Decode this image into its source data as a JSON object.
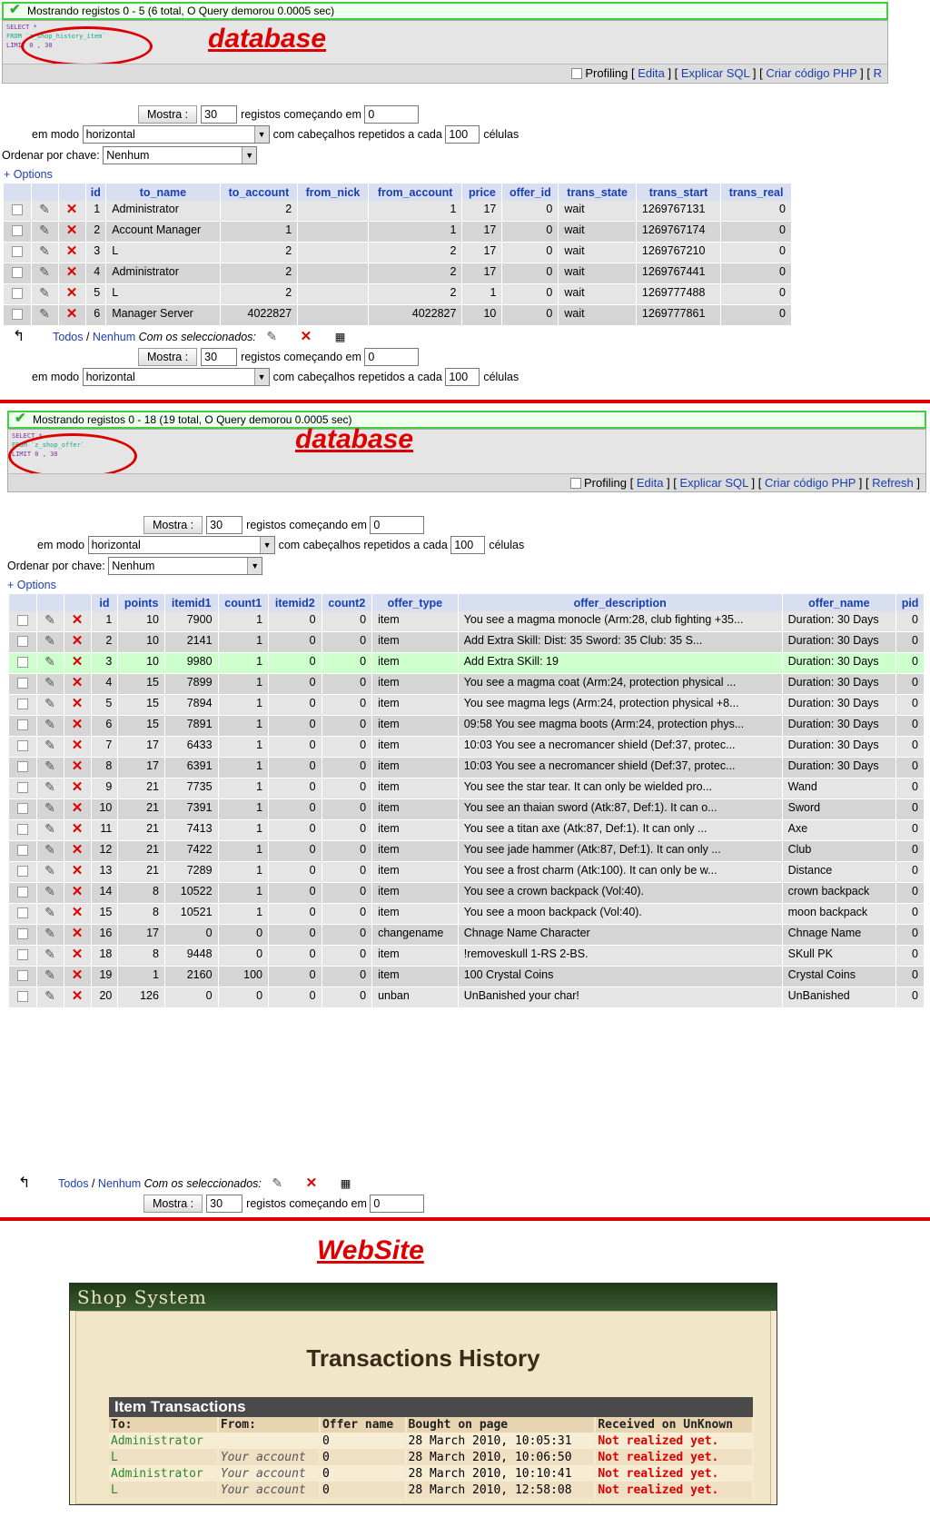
{
  "section1": {
    "message": "Mostrando registos 0 - 5 (6 total, O Query demorou 0.0005 sec)",
    "sql": [
      "SELECT *",
      "FROM `z_shop_history_item`",
      "LIMIT 0 , 30"
    ],
    "annotation": "database",
    "sqlbar": {
      "profiling": "Profiling",
      "edit": "Edita",
      "explain": "Explicar SQL",
      "php": "Criar código PHP",
      "refresh": "R"
    },
    "controls": {
      "show_btn": "Mostra :",
      "rows": "30",
      "start_label": "registos começando em",
      "start": "0",
      "mode_label": "em modo",
      "mode": "horizontal",
      "repeat_label": "com cabeçalhos repetidos a cada",
      "repeat": "100",
      "cells_label": "células",
      "sort_label": "Ordenar por chave:",
      "sort": "Nenhum"
    },
    "options": "+ Options",
    "columns": [
      "id",
      "to_name",
      "to_account",
      "from_nick",
      "from_account",
      "price",
      "offer_id",
      "trans_state",
      "trans_start",
      "trans_real"
    ],
    "rows": [
      [
        "1",
        "Administrator",
        "2",
        "",
        "1",
        "17",
        "0",
        "wait",
        "1269767131",
        "0"
      ],
      [
        "2",
        "Account Manager",
        "1",
        "",
        "1",
        "17",
        "0",
        "wait",
        "1269767174",
        "0"
      ],
      [
        "3",
        "L",
        "2",
        "",
        "2",
        "17",
        "0",
        "wait",
        "1269767210",
        "0"
      ],
      [
        "4",
        "Administrator",
        "2",
        "",
        "2",
        "17",
        "0",
        "wait",
        "1269767441",
        "0"
      ],
      [
        "5",
        "L",
        "2",
        "",
        "2",
        "1",
        "0",
        "wait",
        "1269777488",
        "0"
      ],
      [
        "6",
        "Manager Server",
        "4022827",
        "",
        "4022827",
        "10",
        "0",
        "wait",
        "1269777861",
        "0"
      ]
    ],
    "footer": {
      "all": "Todos",
      "none": "Nenhum",
      "with_selected": "Com os seleccionados:"
    }
  },
  "section2": {
    "message": "Mostrando registos 0 - 18 (19 total, O Query demorou 0.0005 sec)",
    "sql": [
      "SELECT *",
      "FROM `z_shop_offer`",
      "LIMIT 0 , 30"
    ],
    "annotation": "database",
    "sqlbar": {
      "profiling": "Profiling",
      "edit": "Edita",
      "explain": "Explicar SQL",
      "php": "Criar código PHP",
      "refresh": "Refresh"
    },
    "controls": {
      "show_btn": "Mostra :",
      "rows": "30",
      "start_label": "registos começando em",
      "start": "0",
      "mode_label": "em modo",
      "mode": "horizontal",
      "repeat_label": "com cabeçalhos repetidos a cada",
      "repeat": "100",
      "cells_label": "células",
      "sort_label": "Ordenar por chave:",
      "sort": "Nenhum"
    },
    "options": "+ Options",
    "columns": [
      "id",
      "points",
      "itemid1",
      "count1",
      "itemid2",
      "count2",
      "offer_type",
      "offer_description",
      "offer_name",
      "pid"
    ],
    "rows": [
      [
        "1",
        "10",
        "7900",
        "1",
        "0",
        "0",
        "item",
        "You see a magma monocle (Arm:28, club fighting\n+35...",
        "Duration: 30 Days",
        "0"
      ],
      [
        "2",
        "10",
        "2141",
        "1",
        "0",
        "0",
        "item",
        "Add Extra Skill:\nDist: 35\nSword: 35\nClub: 35\nS...",
        "Duration: 30 Days",
        "0"
      ],
      [
        "3",
        "10",
        "9980",
        "1",
        "0",
        "0",
        "item",
        "Add Extra SKill: 19",
        "Duration: 30 Days",
        "0"
      ],
      [
        "4",
        "15",
        "7899",
        "1",
        "0",
        "0",
        "item",
        "You see a magma coat (Arm:24, protection physical ...",
        "Duration: 30 Days",
        "0"
      ],
      [
        "5",
        "15",
        "7894",
        "1",
        "0",
        "0",
        "item",
        "You see magma legs (Arm:24, protection physical +8...",
        "Duration: 30 Days",
        "0"
      ],
      [
        "6",
        "15",
        "7891",
        "1",
        "0",
        "0",
        "item",
        "09:58 You see magma boots (Arm:24, protection\nphys...",
        "Duration: 30 Days",
        "0"
      ],
      [
        "7",
        "17",
        "6433",
        "1",
        "0",
        "0",
        "item",
        "10:03 You see a necromancer shield (Def:37, protec...",
        "Duration: 30 Days",
        "0"
      ],
      [
        "8",
        "17",
        "6391",
        "1",
        "0",
        "0",
        "item",
        "10:03 You see a necromancer shield (Def:37, protec...",
        "Duration: 30 Days",
        "0"
      ],
      [
        "9",
        "21",
        "7735",
        "1",
        "0",
        "0",
        "item",
        "You see the star tear.\nIt can only be wielded pro...",
        "Wand",
        "0"
      ],
      [
        "10",
        "21",
        "7391",
        "1",
        "0",
        "0",
        "item",
        "You see an thaian sword (Atk:87, Def:1).\nIt can o...",
        "Sword",
        "0"
      ],
      [
        "11",
        "21",
        "7413",
        "1",
        "0",
        "0",
        "item",
        "You see a titan axe (Atk:87, Def:1).\nIt can only ...",
        "Axe",
        "0"
      ],
      [
        "12",
        "21",
        "7422",
        "1",
        "0",
        "0",
        "item",
        "You see jade hammer (Atk:87, Def:1).\nIt can only ...",
        "Club",
        "0"
      ],
      [
        "13",
        "21",
        "7289",
        "1",
        "0",
        "0",
        "item",
        "You see a frost charm (Atk:100).\nIt can only be w...",
        "Distance",
        "0"
      ],
      [
        "14",
        "8",
        "10522",
        "1",
        "0",
        "0",
        "item",
        "You see a crown backpack (Vol:40).",
        "crown backpack",
        "0"
      ],
      [
        "15",
        "8",
        "10521",
        "1",
        "0",
        "0",
        "item",
        "You see a moon backpack (Vol:40).",
        "moon backpack",
        "0"
      ],
      [
        "16",
        "17",
        "0",
        "0",
        "0",
        "0",
        "changename",
        "Chnage Name Character",
        "Chnage Name",
        "0"
      ],
      [
        "18",
        "8",
        "9448",
        "0",
        "0",
        "0",
        "item",
        "!removeskull\n1-RS\n2-BS.",
        "SKull PK",
        "0"
      ],
      [
        "19",
        "1",
        "2160",
        "100",
        "0",
        "0",
        "item",
        "100 Crystal Coins",
        "Crystal Coins",
        "0"
      ],
      [
        "20",
        "126",
        "0",
        "0",
        "0",
        "0",
        "unban",
        "UnBanished your char!",
        "UnBanished",
        "0"
      ]
    ],
    "footer": {
      "all": "Todos",
      "none": "Nenhum",
      "with_selected": "Com os seleccionados:"
    }
  },
  "website": {
    "annotation": "WebSite",
    "shop_title": "Shop System",
    "heading": "Transactions History",
    "table_caption": "Item Transactions",
    "columns": [
      "To:",
      "From:",
      "Offer name",
      "Bought on page",
      "Received on UnKnown"
    ],
    "rows": [
      [
        "Administrator",
        "",
        "0",
        "28 March 2010, 10:05:31",
        "Not realized yet."
      ],
      [
        "L",
        "Your account",
        "0",
        "28 March 2010, 10:06:50",
        "Not realized yet."
      ],
      [
        "Administrator",
        "Your account",
        "0",
        "28 March 2010, 10:10:41",
        "Not realized yet."
      ],
      [
        "L",
        "Your account",
        "0",
        "28 March 2010, 12:58:08",
        "Not realized yet."
      ]
    ]
  }
}
